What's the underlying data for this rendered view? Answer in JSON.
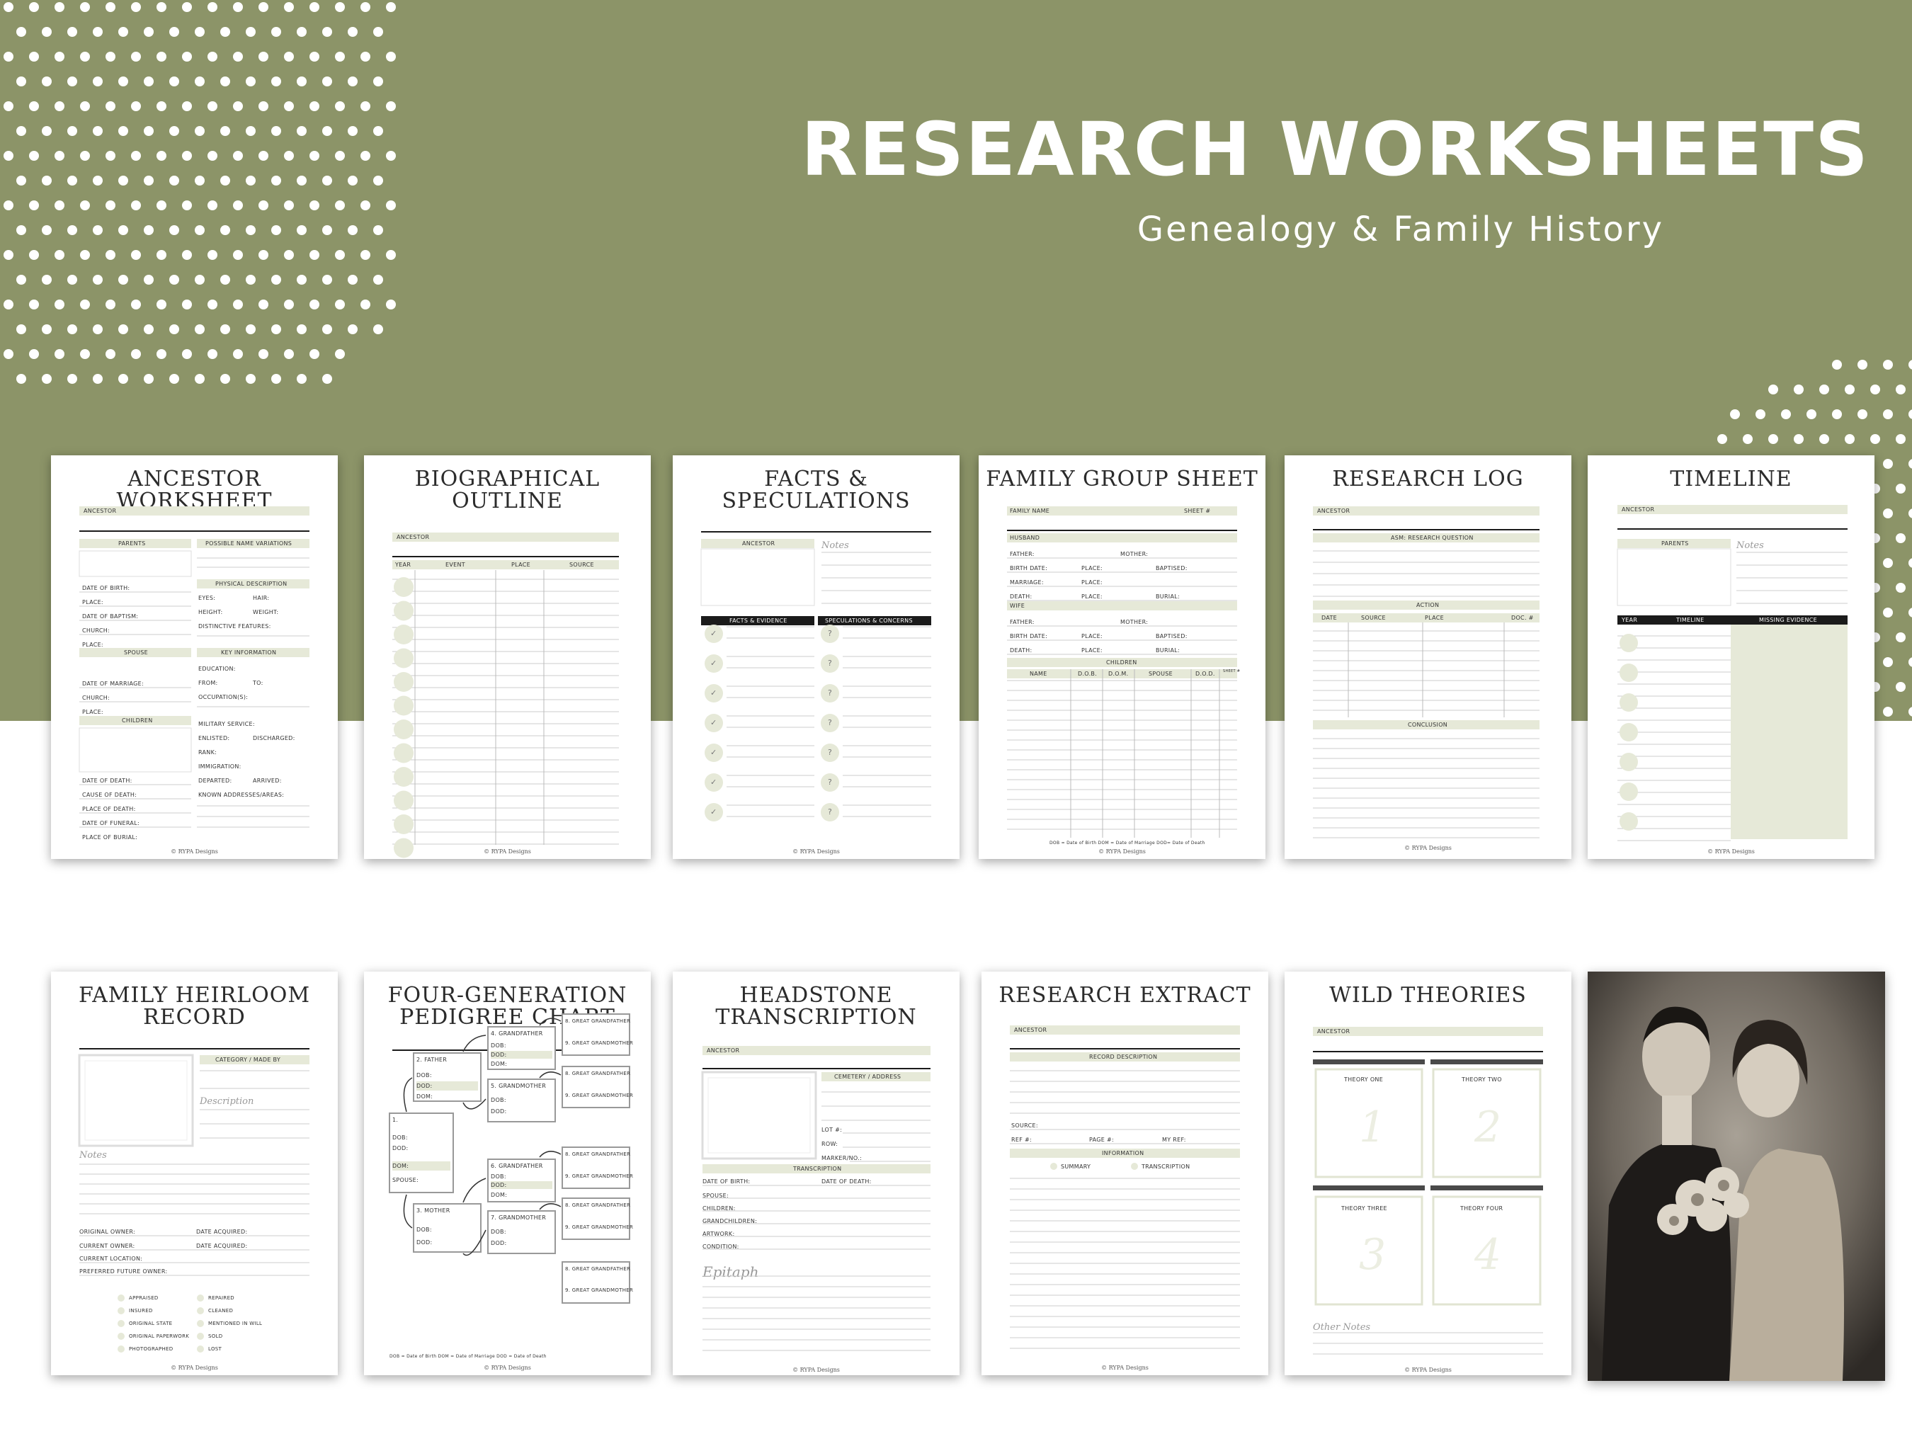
{
  "header": {
    "title": "RESEARCH WORKSHEETS",
    "subtitle": "Genealogy & Family History"
  },
  "colors": {
    "band": "#8c9468",
    "header_fill": "#e6e9d8",
    "dark": "#1b1b1b"
  },
  "sheets": {
    "ancestor": {
      "title": "ANCESTOR WORKSHEET",
      "ancestor": "ANCESTOR",
      "parents": "PARENTS",
      "name_variations": "POSSIBLE NAME VARIATIONS",
      "physical": "PHYSICAL DESCRIPTION",
      "spouse": "SPOUSE",
      "key_info": "KEY INFORMATION",
      "children": "CHILDREN",
      "left_fields": [
        "DATE OF BIRTH:",
        "PLACE:",
        "DATE OF BAPTISM:",
        "CHURCH:",
        "PLACE:"
      ],
      "phys_fields": [
        "EYES:",
        "HAIR:",
        "HEIGHT:",
        "WEIGHT:",
        "DISTINCTIVE FEATURES:"
      ],
      "spouse_fields": [
        "DATE OF MARRIAGE:",
        "CHURCH:",
        "PLACE:"
      ],
      "key_fields": [
        "EDUCATION:",
        "FROM:",
        "TO:",
        "OCCUPATION(S):",
        "MILITARY SERVICE:",
        "ENLISTED:",
        "DISCHARGED:",
        "RANK:",
        "IMMIGRATION:",
        "DEPARTED:",
        "ARRIVED:",
        "KNOWN ADDRESSES/AREAS:"
      ],
      "death_fields": [
        "DATE OF DEATH:",
        "CAUSE OF DEATH:",
        "PLACE OF DEATH:",
        "DATE OF FUNERAL:",
        "PLACE OF BURIAL:"
      ],
      "footer": "© RYPA Designs"
    },
    "bio": {
      "title": "BIOGRAPHICAL\nOUTLINE",
      "ancestor": "ANCESTOR",
      "cols": [
        "YEAR",
        "EVENT",
        "PLACE",
        "SOURCE"
      ],
      "footer": "© RYPA Designs"
    },
    "facts": {
      "title": "FACTS &\nSPECULATIONS",
      "ancestor": "ANCESTOR",
      "notes": "Notes",
      "facts": "FACTS & EVIDENCE",
      "spec": "SPECULATIONS & CONCERNS",
      "check": "✓",
      "question": "?",
      "footer": "© RYPA Designs"
    },
    "family_group": {
      "title": "FAMILY GROUP SHEET",
      "family_name": "FAMILY NAME",
      "sheet_no": "SHEET #",
      "husband": "HUSBAND",
      "wife": "WIFE",
      "father": "FATHER:",
      "mother": "MOTHER:",
      "birth_date": "BIRTH DATE:",
      "place": "PLACE:",
      "baptised": "BAPTISED:",
      "marriage": "MARRIAGE:",
      "death": "DEATH:",
      "burial": "BURIAL:",
      "children": "CHILDREN",
      "child_cols": [
        "NAME",
        "D.O.B.",
        "D.O.M.",
        "SPOUSE",
        "D.O.D.",
        "SHEET #"
      ],
      "legend": "DOB = Date of Birth    DOM = Date of Marriage    DOD= Date of Death",
      "footer": "© RYPA Designs"
    },
    "research_log": {
      "title": "RESEARCH LOG",
      "ancestor": "ANCESTOR",
      "question": "ASM: RESEARCH QUESTION",
      "action": "ACTION",
      "cols": [
        "DATE",
        "SOURCE",
        "PLACE",
        "DOC. #"
      ],
      "conclusion": "CONCLUSION",
      "footer": "© RYPA Designs"
    },
    "timeline": {
      "title": "TIMELINE",
      "ancestor": "ANCESTOR",
      "parents": "PARENTS",
      "notes": "Notes",
      "cols": [
        "YEAR",
        "TIMELINE",
        "MISSING EVIDENCE"
      ],
      "footer": "© RYPA Designs"
    },
    "heirloom": {
      "title": "FAMILY HEIRLOOM\nRECORD",
      "category": "CATEGORY / MADE BY",
      "description": "Description",
      "notes": "Notes",
      "fields": [
        "ORIGINAL OWNER:",
        "DATE ACQUIRED:",
        "CURRENT OWNER:",
        "DATE ACQUIRED:",
        "CURRENT LOCATION:",
        "PREFERRED FUTURE OWNER:"
      ],
      "checks_left": [
        "APPRAISED",
        "INSURED",
        "ORIGINAL STATE",
        "ORIGINAL PAPERWORK",
        "PHOTOGRAPHED"
      ],
      "checks_right": [
        "REPAIRED",
        "CLEANED",
        "MENTIONED IN WILL",
        "SOLD",
        "LOST"
      ],
      "footer": "© RYPA Designs"
    },
    "pedigree": {
      "title": "FOUR-GENERATION\nPEDIGREE CHART",
      "father": "2. FATHER",
      "mother": "3. MOTHER",
      "gf4": "4. GRANDFATHER",
      "gm5": "5. GRANDMOTHER",
      "gf6": "6. GRANDFATHER",
      "gm7": "7. GRANDMOTHER",
      "ggf": "8. GREAT GRANDFATHER",
      "ggm": "9. GREAT GRANDMOTHER",
      "dob": "DOB:",
      "dod": "DOD:",
      "dom": "DOM:",
      "self": "1.",
      "spouse": "SPOUSE:",
      "legend": "DOB = Date of Birth    DOM = Date of Marriage    DOD = Date of Death",
      "footer": "© RYPA Designs"
    },
    "headstone": {
      "title": "HEADSTONE\nTRANSCRIPTION",
      "ancestor": "ANCESTOR",
      "cemetery": "CEMETERY / ADDRESS",
      "lot": "LOT #:",
      "row": "ROW:",
      "marker": "MARKER/NO.:",
      "transcription": "TRANSCRIPTION",
      "birth": "DATE OF BIRTH:",
      "death": "DATE OF DEATH:",
      "fields": [
        "SPOUSE:",
        "CHILDREN:",
        "GRANDCHILDREN:",
        "ARTWORK:",
        "CONDITION:"
      ],
      "epitaph": "Epitaph",
      "footer": "© RYPA Designs"
    },
    "extract": {
      "title": "RESEARCH EXTRACT",
      "ancestor": "ANCESTOR",
      "record": "RECORD DESCRIPTION",
      "source": "SOURCE:",
      "ref": "REF #:",
      "page": "PAGE #:",
      "my_ref": "MY REF:",
      "information": "INFORMATION",
      "summary": "SUMMARY",
      "transcription": "TRANSCRIPTION",
      "footer": "© RYPA Designs"
    },
    "wild": {
      "title": "WILD THEORIES",
      "ancestor": "ANCESTOR",
      "theories": [
        "THEORY ONE",
        "THEORY TWO",
        "THEORY THREE",
        "THEORY FOUR"
      ],
      "numbers": [
        "1",
        "2",
        "3",
        "4"
      ],
      "other_notes": "Other Notes",
      "footer": "© RYPA Designs"
    }
  }
}
